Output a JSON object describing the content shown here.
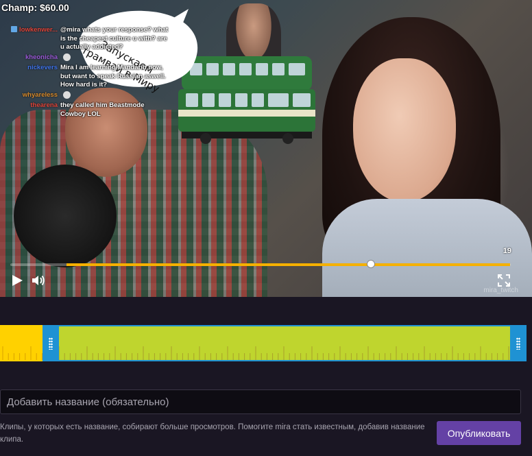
{
  "overlay": {
    "champ_label": "Champ: $60.00",
    "bubble_lines": [
      "Запускаем",
      "трамвай в Миру"
    ]
  },
  "chat": [
    {
      "user": "lowkenwer...",
      "user_color": "#e0453a",
      "text": "@mira whats your response? what is the cheapest culture u with? are u actually addicted?",
      "badge": true,
      "emote": false
    },
    {
      "user": "kheonicha",
      "user_color": "#9a59d6",
      "text": "",
      "badge": false,
      "emote": true
    },
    {
      "user": "nickevers",
      "user_color": "#3f73e8",
      "text": "Mira I am learning Mandarin now, but want to speak Russian aswell. How hard is it?",
      "badge": false,
      "emote": false
    },
    {
      "user": "whyareless",
      "user_color": "#d88a2b",
      "text": "",
      "badge": false,
      "emote": true
    },
    {
      "user": "thearena",
      "user_color": "#e0453a",
      "text": "they called him Beastmode Cowboy LOL",
      "badge": false,
      "emote": false
    }
  ],
  "player": {
    "timecode": "19",
    "progress_start": 0.113,
    "progress_end": 0.998,
    "playhead": 0.72,
    "play_icon": "play-icon",
    "volume_icon": "volume-icon",
    "fullscreen_icon": "fullscreen-icon",
    "watermark": "mira_twitch",
    "accent": "#f5b000"
  },
  "clip_range": {
    "colors": {
      "pre": "#ffd100",
      "selection": "#bfd52e",
      "handle": "#1f92d3"
    }
  },
  "form": {
    "title_placeholder": "Добавить название (обязательно)",
    "title_value": "",
    "hint": "Клипы, у которых есть название, собирают больше просмотров. Помогите mira стать известным, добавив название клипа.",
    "publish_label": "Опубликовать",
    "publish_color": "#6441a5"
  }
}
